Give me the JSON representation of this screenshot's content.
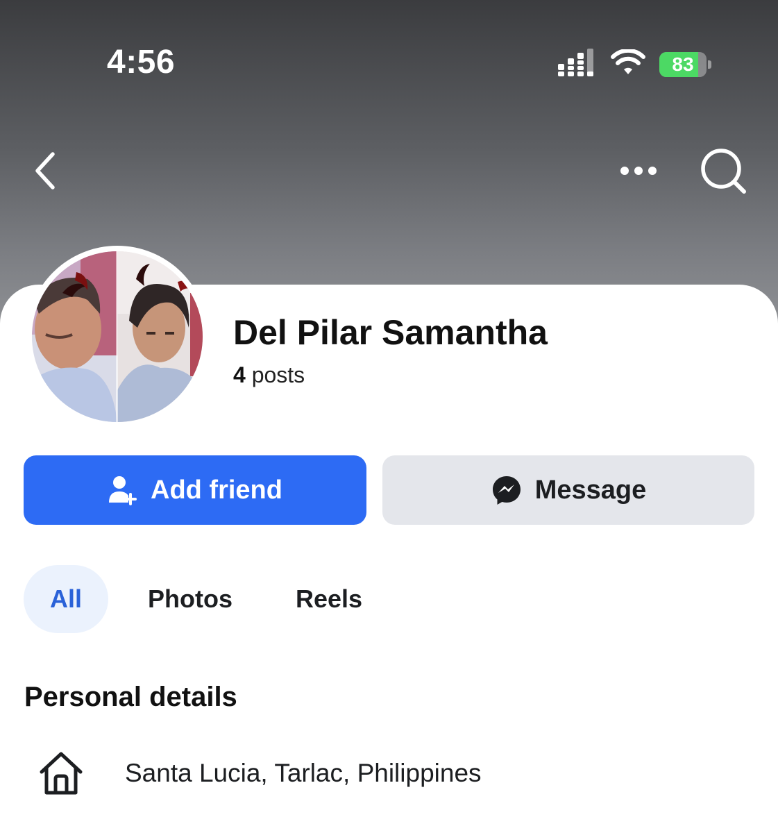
{
  "status_bar": {
    "time": "4:56",
    "battery_text": "83",
    "battery_level": 0.83,
    "battery_color": "#4cd964"
  },
  "nav": {
    "back_icon": "chevron-left-icon",
    "more_icon": "more-horizontal-icon",
    "search_icon": "search-icon"
  },
  "profile": {
    "name": "Del Pilar Samantha",
    "posts_count": "4",
    "posts_label": " posts"
  },
  "actions": {
    "add_friend_label": "Add friend",
    "add_friend_icon": "add-person-icon",
    "add_friend_color": "#2d6bf4",
    "message_label": "Message",
    "message_icon": "messenger-icon"
  },
  "tabs": [
    {
      "label": "All",
      "selected": true
    },
    {
      "label": "Photos",
      "selected": false
    },
    {
      "label": "Reels",
      "selected": false
    }
  ],
  "personal_details": {
    "title": "Personal details",
    "items": [
      {
        "icon": "home-icon",
        "text": "Santa Lucia, Tarlac, Philippines"
      }
    ]
  }
}
